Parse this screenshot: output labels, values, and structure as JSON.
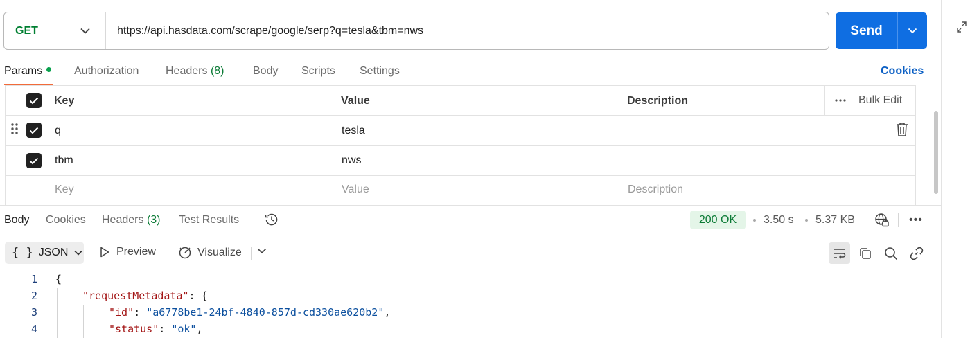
{
  "request": {
    "method": "GET",
    "url": "https://api.hasdata.com/scrape/google/serp?q=tesla&tbm=nws",
    "send_label": "Send"
  },
  "request_tabs": {
    "params": "Params",
    "authorization": "Authorization",
    "headers": "Headers",
    "headers_count": "(8)",
    "body": "Body",
    "scripts": "Scripts",
    "settings": "Settings",
    "cookies": "Cookies"
  },
  "params_table": {
    "headers": {
      "key": "Key",
      "value": "Value",
      "description": "Description",
      "bulk_edit": "Bulk Edit"
    },
    "rows": [
      {
        "key": "q",
        "value": "tesla",
        "description": "",
        "checked": true
      },
      {
        "key": "tbm",
        "value": "nws",
        "description": "",
        "checked": true
      }
    ],
    "placeholders": {
      "key": "Key",
      "value": "Value",
      "description": "Description"
    }
  },
  "response_tabs": {
    "body": "Body",
    "cookies": "Cookies",
    "headers": "Headers",
    "headers_count": "(3)",
    "test_results": "Test Results"
  },
  "response_meta": {
    "status": "200 OK",
    "time": "3.50 s",
    "size": "5.37 KB",
    "more": "•••"
  },
  "response_toolbar": {
    "format": "JSON",
    "format_brace": "{ }",
    "preview": "Preview",
    "visualize": "Visualize"
  },
  "code": {
    "line_numbers": [
      "1",
      "2",
      "3",
      "4"
    ],
    "open_brace": "{",
    "request_metadata_key": "\"requestMetadata\"",
    "request_metadata_sep": ": {",
    "id_key": "\"id\"",
    "id_value": "\"a6778be1-24bf-4840-857d-cd330ae620b2\"",
    "status_key": "\"status\"",
    "status_value": "\"ok\"",
    "colon": ": ",
    "comma": ","
  },
  "colors": {
    "send": "#0f6ee2",
    "method": "#007f31",
    "tab_underline": "#f26b3a",
    "status_bg": "#e4f5e8",
    "cookies_link": "#0b5fc4"
  },
  "icons": [
    "chevron-down-icon",
    "expand-icon",
    "drag-handle-icon",
    "trash-icon",
    "more-icon",
    "history-icon",
    "globe-lock-icon",
    "play-icon",
    "visualize-icon",
    "wrap-icon",
    "copy-icon",
    "search-icon",
    "link-icon",
    "check-icon"
  ]
}
